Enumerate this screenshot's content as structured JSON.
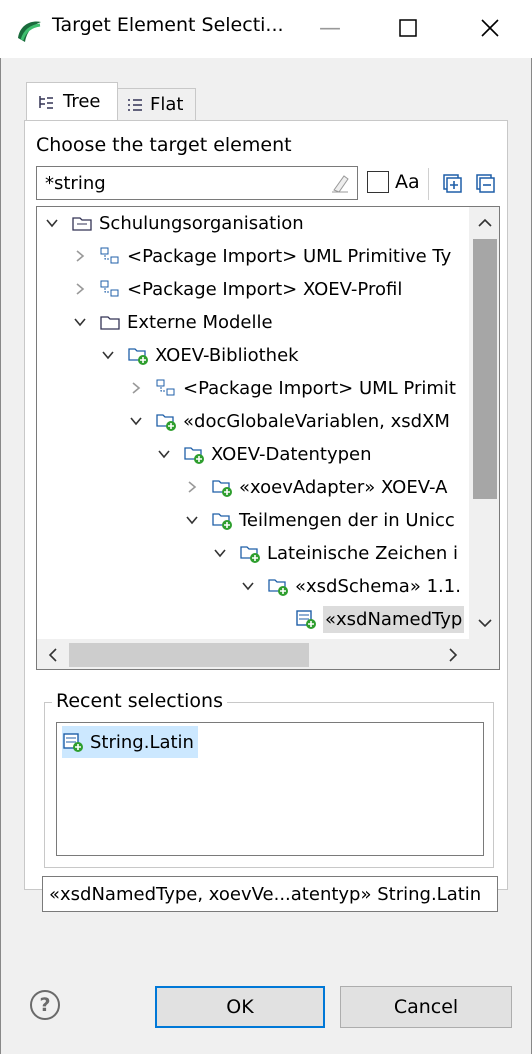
{
  "window": {
    "title": "Target Element Selecti...",
    "min_glyph": "—",
    "max_glyph": "☐",
    "close_glyph": "✕"
  },
  "tabs": [
    {
      "label": "Tree",
      "icon": "tree-icon",
      "active": true
    },
    {
      "label": "Flat",
      "icon": "list-icon",
      "active": false
    }
  ],
  "prompt": "Choose the target element",
  "search": {
    "value": "*string",
    "case_label": "Aa"
  },
  "tree": {
    "items": [
      {
        "label": "Schulungsorganisation",
        "depth": 0,
        "expanded": true,
        "icon": "package-icon"
      },
      {
        "label": "<Package Import> UML Primitive Ty",
        "depth": 1,
        "expanded": false,
        "icon": "package-import-icon"
      },
      {
        "label": "<Package Import> XOEV-Profil",
        "depth": 1,
        "expanded": false,
        "icon": "package-import-icon"
      },
      {
        "label": "Externe Modelle",
        "depth": 1,
        "expanded": true,
        "icon": "folder-icon"
      },
      {
        "label": "XOEV-Bibliothek",
        "depth": 2,
        "expanded": true,
        "icon": "package-add-icon"
      },
      {
        "label": "<Package Import> UML Primit",
        "depth": 3,
        "expanded": false,
        "icon": "package-import-icon"
      },
      {
        "label": "«docGlobaleVariablen, xsdXM",
        "depth": 3,
        "expanded": true,
        "icon": "package-add-icon"
      },
      {
        "label": "XOEV-Datentypen",
        "depth": 4,
        "expanded": true,
        "icon": "package-add-icon"
      },
      {
        "label": "«xoevAdapter» XOEV-A",
        "depth": 5,
        "expanded": false,
        "icon": "package-add-icon"
      },
      {
        "label": "Teilmengen der in Unicc",
        "depth": 5,
        "expanded": true,
        "icon": "package-add-icon"
      },
      {
        "label": "Lateinische Zeichen i",
        "depth": 6,
        "expanded": true,
        "icon": "package-add-icon"
      },
      {
        "label": "«xsdSchema» 1.1.",
        "depth": 7,
        "expanded": true,
        "icon": "package-add-icon"
      },
      {
        "label": "«xsdNamedTyp",
        "depth": 8,
        "expanded": null,
        "icon": "class-add-icon",
        "selected": true
      }
    ]
  },
  "recent": {
    "label": "Recent selections",
    "items": [
      {
        "label": "String.Latin",
        "icon": "class-add-icon"
      }
    ]
  },
  "path": "«xsdNamedType, xoevVe...atentyp» String.Latin",
  "buttons": {
    "help": "?",
    "ok": "OK",
    "cancel": "Cancel"
  },
  "colors": {
    "selection": "#cce8ff",
    "default_button_border": "#0078d7",
    "icon_green": "#2e9e2e",
    "icon_blue": "#1f5fa8"
  }
}
